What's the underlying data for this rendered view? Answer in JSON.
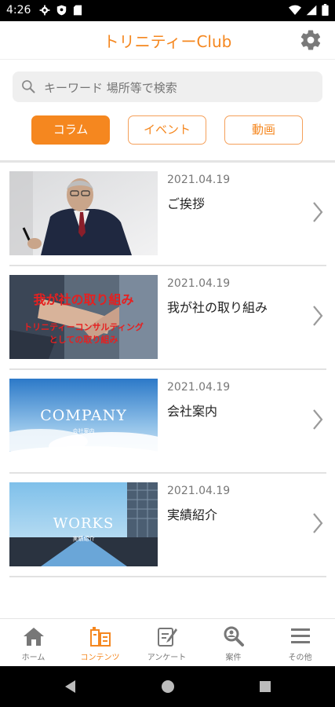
{
  "status_bar": {
    "time": "4:26"
  },
  "header": {
    "title": "トリニティーClub"
  },
  "search": {
    "placeholder": "キーワード 場所等で検索"
  },
  "tabs": [
    {
      "label": "コラム",
      "active": true
    },
    {
      "label": "イベント",
      "active": false
    },
    {
      "label": "動画",
      "active": false
    }
  ],
  "articles": [
    {
      "date": "2021.04.19",
      "title": "ご挨拶",
      "thumb": {
        "kind": "portrait"
      }
    },
    {
      "date": "2021.04.19",
      "title": "我が社の取り組み",
      "thumb": {
        "kind": "handshake",
        "heading": "我が社の取り組み",
        "subheading_line1": "トリニティーコンサルティング",
        "subheading_line2": "としての取り組み"
      }
    },
    {
      "date": "2021.04.19",
      "title": "会社案内",
      "thumb": {
        "kind": "clouds",
        "heading": "COMPANY",
        "subheading": "会社案内"
      }
    },
    {
      "date": "2021.04.19",
      "title": "実績紹介",
      "thumb": {
        "kind": "building",
        "heading": "WORKS",
        "subheading": "実績紹介"
      }
    }
  ],
  "bottom_nav": [
    {
      "label": "ホーム",
      "icon": "home-icon",
      "active": false
    },
    {
      "label": "コンテンツ",
      "icon": "contents-icon",
      "active": true
    },
    {
      "label": "アンケート",
      "icon": "survey-icon",
      "active": false
    },
    {
      "label": "案件",
      "icon": "search-jobs-icon",
      "active": false
    },
    {
      "label": "その他",
      "icon": "menu-icon",
      "active": false
    }
  ],
  "colors": {
    "accent": "#f5871f",
    "divider": "#e2e2e2",
    "search_bg": "#efefef"
  }
}
